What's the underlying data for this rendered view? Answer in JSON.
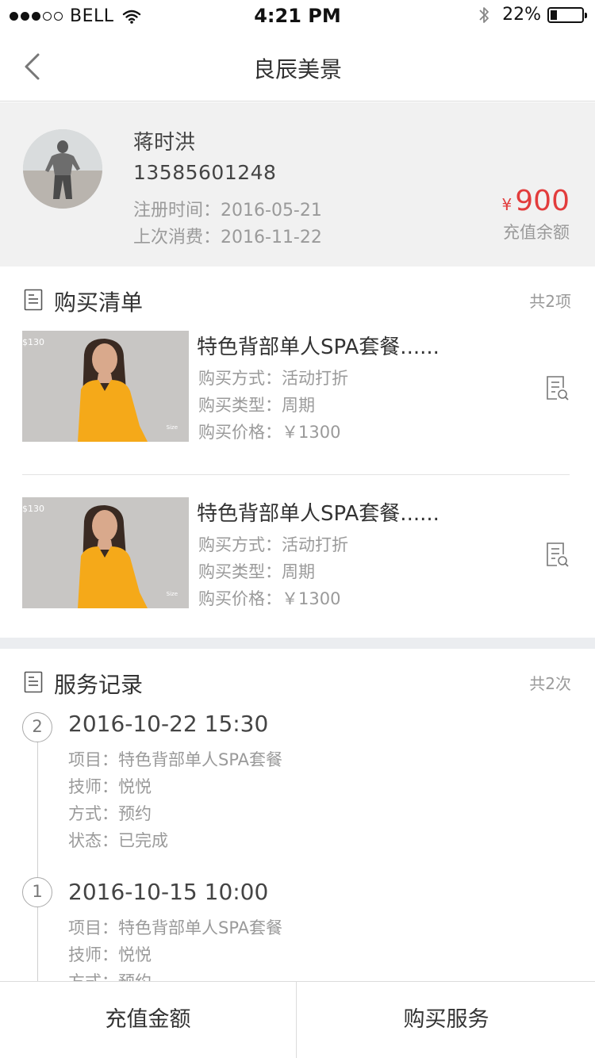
{
  "status_bar": {
    "carrier": "BELL",
    "time": "4:21 PM",
    "battery_percent": "22%",
    "battery_level": 0.22,
    "signal_bars_filled": 3,
    "signal_bars_total": 5
  },
  "nav": {
    "title": "良辰美景",
    "back_icon": "chevron-left-icon"
  },
  "profile": {
    "name": "蒋时洪",
    "phone": "13585601248",
    "register_label": "注册时间：",
    "register_date": "2016-05-21",
    "last_spend_label": "上次消费：",
    "last_spend_date": "2016-11-22",
    "balance_currency": "¥",
    "balance_amount": "900",
    "balance_label": "充值余额"
  },
  "purchase": {
    "title": "购买清单",
    "count": "共2项",
    "items": [
      {
        "image_price": "$130",
        "image_size": "Size",
        "title": "特色背部单人SPA套餐......",
        "method": "购买方式：活动打折",
        "type": "购买类型：周期",
        "price": "购买价格：￥1300"
      },
      {
        "image_price": "$130",
        "image_size": "Size",
        "title": "特色背部单人SPA套餐......",
        "method": "购买方式：活动打折",
        "type": "购买类型：周期",
        "price": "购买价格：￥1300"
      }
    ]
  },
  "service": {
    "title": "服务记录",
    "count": "共2次",
    "records": [
      {
        "index": "2",
        "datetime": "2016-10-22 15:30",
        "project": "项目：特色背部单人SPA套餐",
        "technician": "技师：悦悦",
        "mode": "方式：预约",
        "status": "状态：已完成"
      },
      {
        "index": "1",
        "datetime": "2016-10-15 10:00",
        "project": "项目：特色背部单人SPA套餐",
        "technician": "技师：悦悦",
        "mode": "方式：预约"
      }
    ]
  },
  "bottom": {
    "recharge": "充值金额",
    "buy_service": "购买服务"
  },
  "colors": {
    "accent_red": "#e23c3c",
    "muted_text": "#9a9a9a",
    "profile_bg": "#f1f1f1"
  }
}
